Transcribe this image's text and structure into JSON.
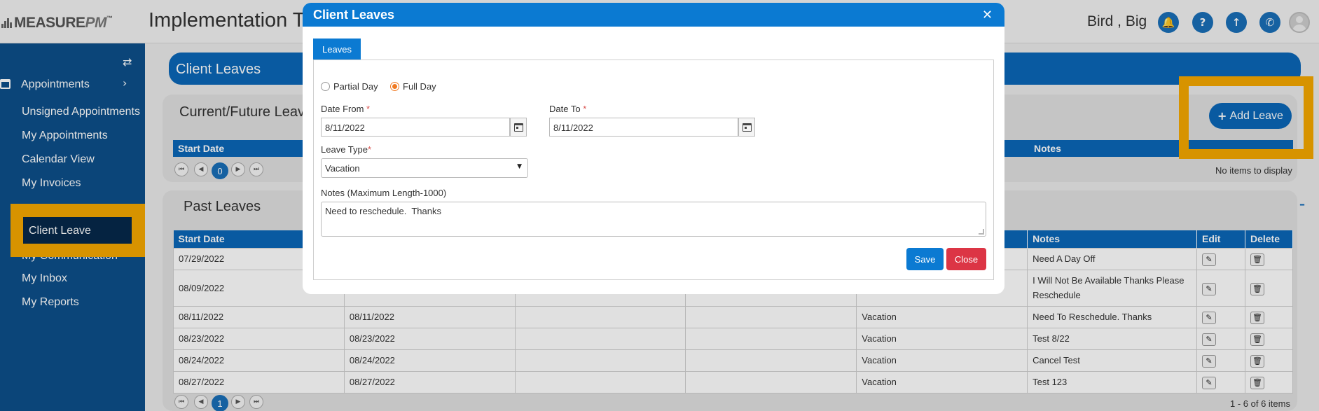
{
  "header": {
    "logo_text": "MEASURE",
    "logo_pm": "PM",
    "logo_tm": "™",
    "app_title": "Implementation T",
    "user_name": "Bird , Big",
    "icons": [
      "bell-icon",
      "help-icon",
      "upload-icon",
      "phone-icon",
      "avatar"
    ]
  },
  "sidebar": {
    "section_label": "Appointments",
    "items": [
      {
        "label": "Unsigned Appointments"
      },
      {
        "label": "My Appointments"
      },
      {
        "label": "Calendar View"
      },
      {
        "label": "My Invoices"
      },
      {
        "label": "Client Leave"
      },
      {
        "label": "My Communication"
      },
      {
        "label": "My Inbox"
      },
      {
        "label": "My Reports"
      }
    ]
  },
  "main": {
    "banner_title": "Client Leaves",
    "current_title": "Current/Future Leav",
    "add_leave_label": "Add Leave",
    "current_grid": {
      "headers": {
        "start_date": "Start Date",
        "notes": "Notes"
      },
      "page": "0",
      "empty_text": "No items to display"
    },
    "past_title": "Past Leaves",
    "past_grid": {
      "headers": [
        "Start Date",
        "",
        "",
        "",
        "",
        "Notes",
        "Edit",
        "Delete"
      ],
      "rows": [
        {
          "start": "07/29/2022",
          "end": "",
          "type": "",
          "notes": "Need A Day Off"
        },
        {
          "start": "08/09/2022",
          "end": "",
          "type": "",
          "notes": "I Will Not Be Available Thanks Please Reschedule"
        },
        {
          "start": "08/11/2022",
          "end": "08/11/2022",
          "type": "Vacation",
          "notes": "Need To Reschedule. Thanks"
        },
        {
          "start": "08/23/2022",
          "end": "08/23/2022",
          "type": "Vacation",
          "notes": "Test 8/22"
        },
        {
          "start": "08/24/2022",
          "end": "08/24/2022",
          "type": "Vacation",
          "notes": "Cancel Test"
        },
        {
          "start": "08/27/2022",
          "end": "08/27/2022",
          "type": "Vacation",
          "notes": "Test 123"
        }
      ],
      "page": "1",
      "items_info": "1 - 6 of 6 items"
    }
  },
  "modal": {
    "title": "Client Leaves",
    "tab_label": "Leaves",
    "partial_day_label": "Partial Day",
    "full_day_label": "Full Day",
    "selected": "Full Day",
    "date_from_label": "Date From",
    "date_from_value": "8/11/2022",
    "date_to_label": "Date To",
    "date_to_value": "8/11/2022",
    "required_mark": "*",
    "leave_type_label": "Leave Type",
    "leave_type_value": "Vacation",
    "notes_label": "Notes (Maximum Length-1000)",
    "notes_value": "Need to reschedule.  Thanks",
    "save_label": "Save",
    "close_label": "Close"
  },
  "colors": {
    "primary": "#0b67b8",
    "modal_header": "#0b7ad2",
    "sidebar": "#0d4f8a",
    "highlight": "#f5a800",
    "save": "#0b7ad2",
    "close": "#dc3545",
    "radio_active": "#f07a22"
  }
}
